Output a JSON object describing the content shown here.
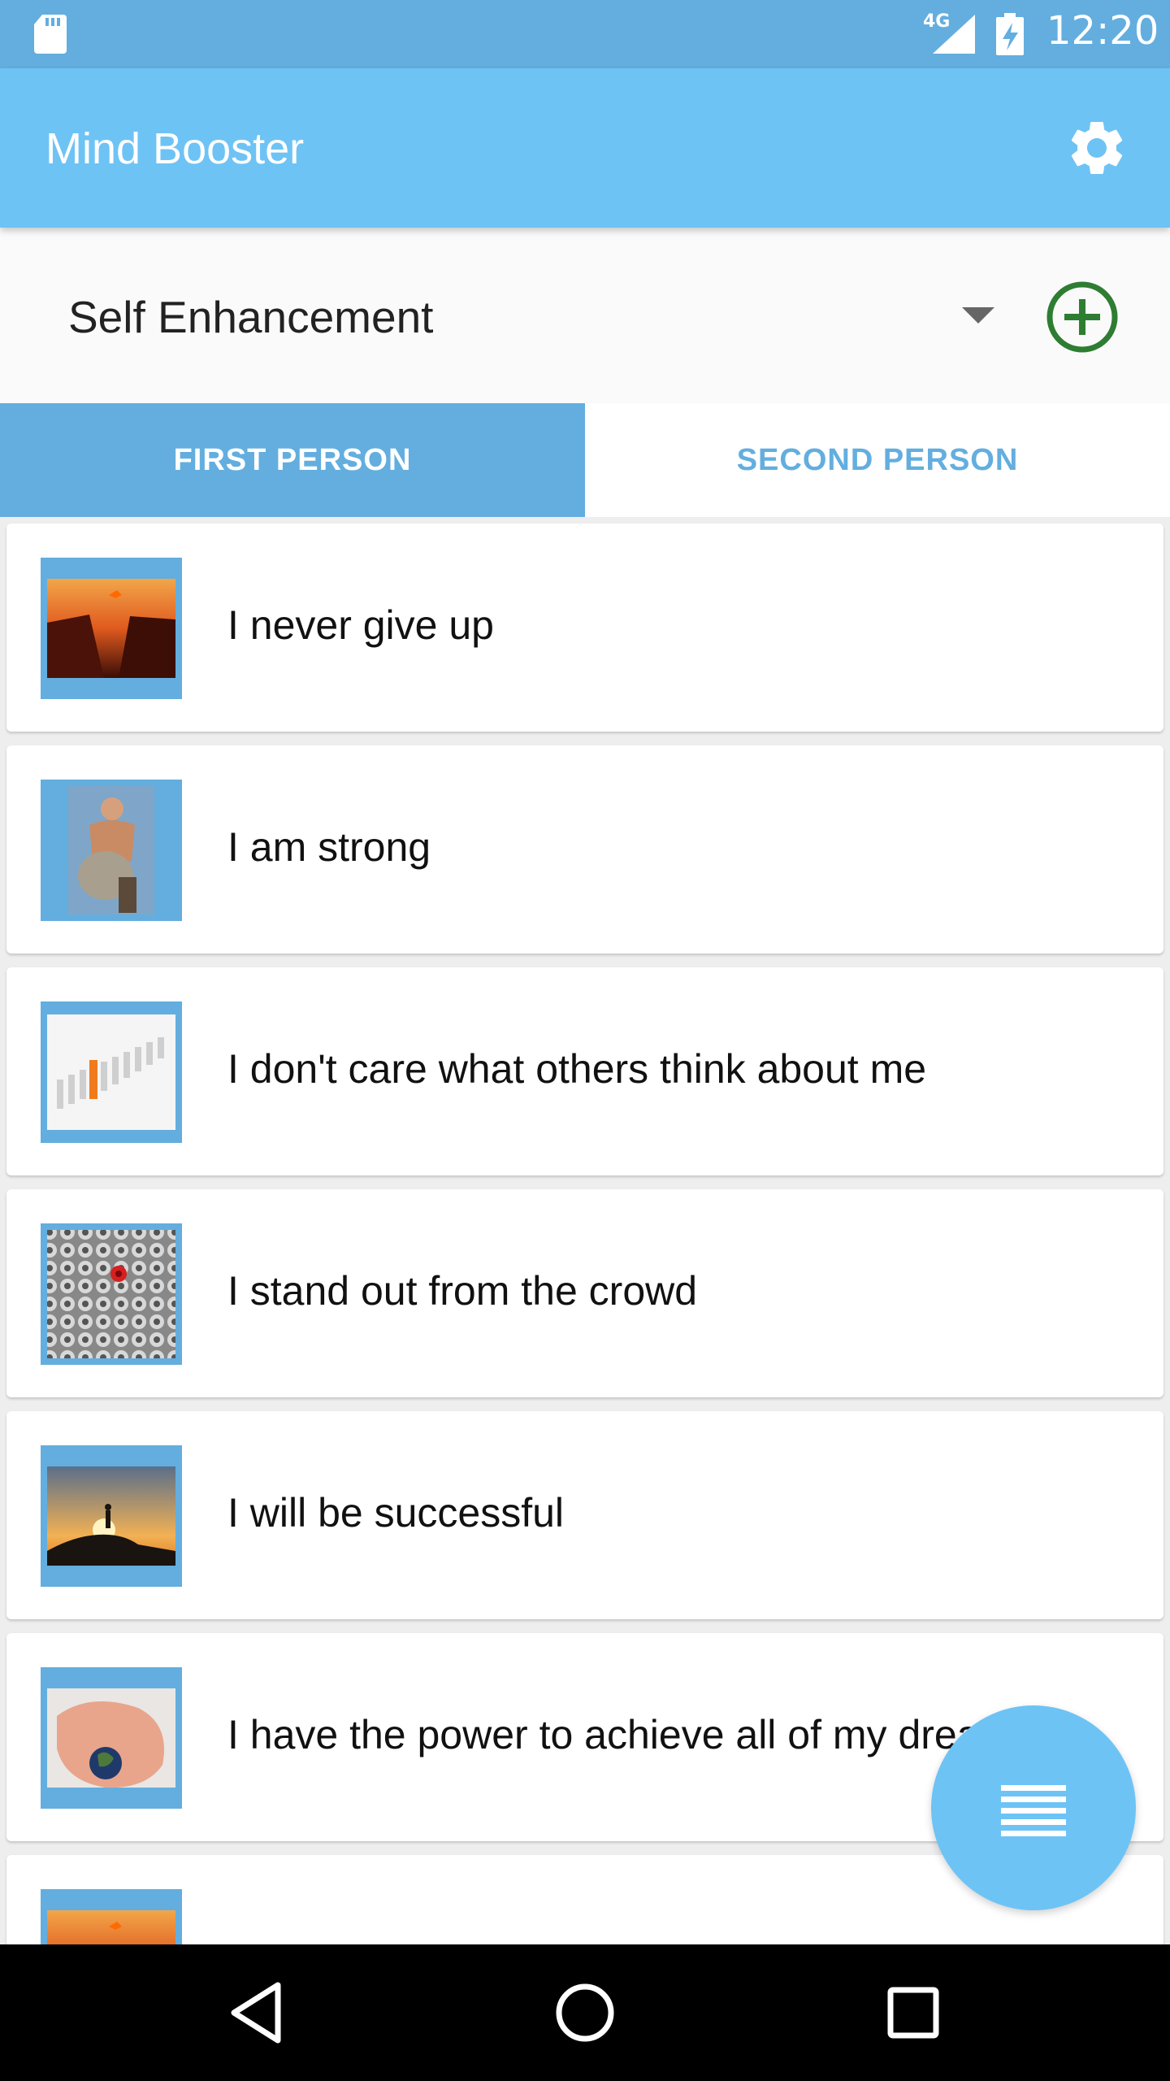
{
  "status_bar": {
    "network": "4G",
    "time": "12:20"
  },
  "app_bar": {
    "title": "Mind Booster",
    "settings_icon": "gear-icon"
  },
  "category": {
    "selected": "Self Enhancement",
    "add_icon": "plus-circle-icon",
    "accent_color": "#2e7d32"
  },
  "tabs": [
    {
      "label": "FIRST PERSON",
      "selected": true
    },
    {
      "label": "SECOND PERSON",
      "selected": false
    }
  ],
  "affirmations": [
    {
      "text": "I never give up",
      "image": "jumping-canyon-sunset"
    },
    {
      "text": "I am strong",
      "image": "man-lifting-rock"
    },
    {
      "text": "I don't care what others think about me",
      "image": "orange-figure-among-crowd"
    },
    {
      "text": "I stand out from the crowd",
      "image": "red-nut-among-nuts"
    },
    {
      "text": "I will be successful",
      "image": "person-on-mountain-sunset"
    },
    {
      "text": "I have the power to achieve all of my dreams",
      "image": "hand-holding-earth"
    },
    {
      "text": "",
      "image": "jumping-canyon-sunset"
    }
  ],
  "fab": {
    "icon": "list-icon"
  },
  "nav_bar": {
    "back_icon": "back-triangle-icon",
    "home_icon": "home-circle-icon",
    "recent_icon": "recent-square-icon"
  },
  "colors": {
    "status_bar": "#63aedf",
    "app_bar": "#6ec3f5",
    "tab_selected": "#63aedf"
  }
}
